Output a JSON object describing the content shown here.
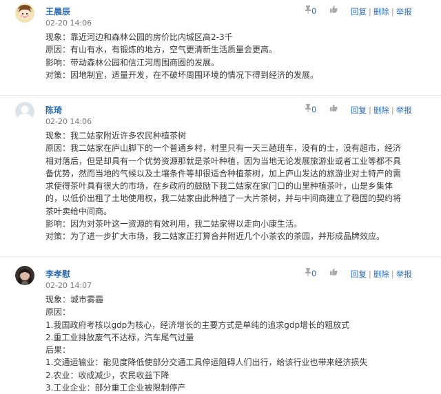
{
  "actions": {
    "reply": "回复",
    "delete": "删除",
    "report": "举报",
    "separator": "|"
  },
  "comments": [
    {
      "author": "王晨辰",
      "date": "02-20 14:06",
      "likes": "0",
      "lines": [
        "现象：靠近河边和森林公园的房价比内城区高2-3千",
        "原因：有山有水，有锻炼的地方，空气更清新生活质量会更高。",
        "影响：带动森林公园和信江河周围商圈的发展。",
        "对策：因地制宜，适量开发，在不破坏周围环境的情况下得到经济的发展。"
      ]
    },
    {
      "author": "陈琦",
      "date": "02-20 14:06",
      "likes": "0",
      "lines": [
        "现象：我二姑家附近许多农民种植茶树",
        "原因：我二姑家在庐山脚下的一个普通乡村，村里只有一天三趟班车，没有的士，没有超市，经济",
        "相对落后，但是却具有一个优势资源那就是茶叶种植，因为当地无论发展旅游业或者工业等都不具",
        "备优势，然而当地的气候以及土壤条件等却很适合种植茶树，加上庐山发达的旅游业对土特产的需",
        "求使得茶叶具有很大的市场，在乡政府的鼓励下我二姑家在家门口的山里种植茶叶，山是乡集体",
        "的，以低价出租了土地使用权，我二姑家由此种植了一大片茶树，并与中间商建立了稳固的契约将",
        "茶叶卖给中间商。",
        "影响：因为对茶叶这一资源的有效利用，我二姑家得以走向小康生活。",
        "对策：为了进一步扩大市场，我二姑家正打算合并附近几个小茶农的茶园，并形成品牌效应。"
      ]
    },
    {
      "author": "李孝慰",
      "date": "02-20 14:07",
      "likes": "0",
      "lines": [
        "现象：城市雾霾",
        "原因：",
        "1.我国政府考核以gdp为核心，经济增长的主要方式是单纯的追求gdp增长的粗放式",
        "2.重工业排放废气不达标，汽车尾气过量",
        "后果：",
        "1.交通运输业：能见度降低使部分交通工具停运阻碍人们出行，给该行业也带来经济损失",
        "2.农业：收成减少，农民收益下降",
        "3.工业企业：部分重工企业被限制停产"
      ]
    }
  ]
}
